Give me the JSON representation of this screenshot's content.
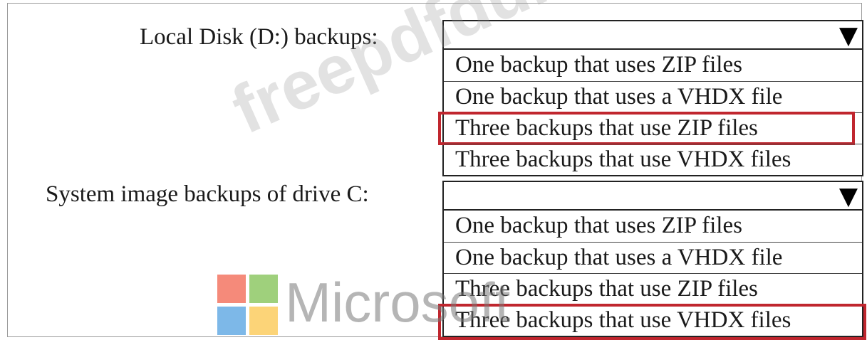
{
  "questions": [
    {
      "label": "Local Disk (D:) backups:",
      "selected_value": "",
      "options": [
        "One backup that uses ZIP files",
        "One backup that uses a VHDX file",
        "Three backups that use ZIP files",
        "Three backups that use VHDX files"
      ],
      "highlighted_option": "Three backups that use ZIP files"
    },
    {
      "label": "System image backups of drive C:",
      "selected_value": "",
      "options": [
        "One backup that uses ZIP files",
        "One backup that uses a VHDX file",
        "Three backups that use ZIP files",
        "Three backups that use VHDX files"
      ],
      "highlighted_option": "Three backups that use VHDX files"
    }
  ],
  "dropdown_arrow_icon": "triangle-down-icon",
  "watermark": {
    "text": "freepdfdumps.com",
    "logo_text": "Microsoft",
    "logo_colors": [
      "#f58a7a",
      "#9fd07c",
      "#7db8e8",
      "#fcd478"
    ]
  },
  "highlight_color": "#c0262e"
}
